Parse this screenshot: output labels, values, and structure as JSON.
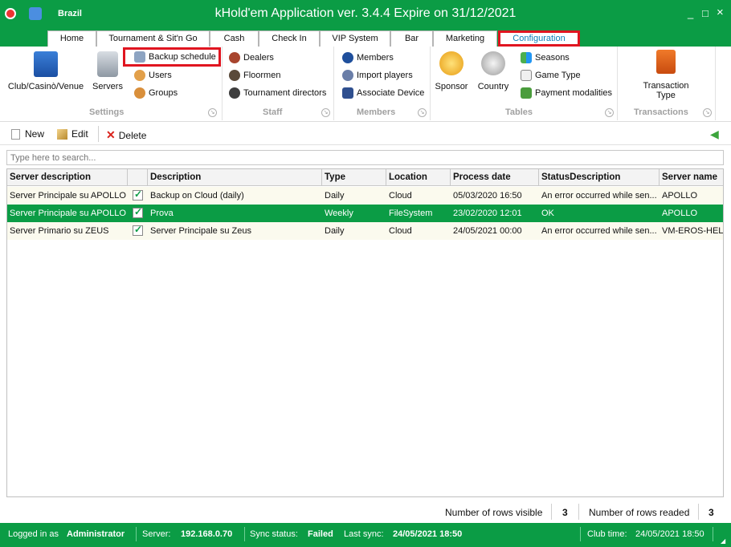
{
  "window": {
    "title": "kHold'em Application ver. 3.4.4 Expire on 31/12/2021",
    "club": "Brazil",
    "minimize": "_",
    "maximize": "□",
    "close": "×"
  },
  "tabs": [
    "Home",
    "Tournament & Sit'n Go",
    "Cash",
    "Check In",
    "VIP System",
    "Bar",
    "Marketing",
    "Configuration"
  ],
  "ribbon": {
    "settings": {
      "label": "Settings",
      "club": "Club/Casinò/Venue",
      "servers": "Servers",
      "backup": "Backup schedule",
      "users": "Users",
      "groups": "Groups"
    },
    "staff": {
      "label": "Staff",
      "dealers": "Dealers",
      "floormen": "Floormen",
      "directors": "Tournament directors"
    },
    "members": {
      "label": "Members",
      "members": "Members",
      "import": "Import players",
      "device": "Associate Device"
    },
    "tables": {
      "label": "Tables",
      "sponsor": "Sponsor",
      "country": "Country",
      "seasons": "Seasons",
      "gametype": "Game Type",
      "payment": "Payment modalities"
    },
    "transactions": {
      "label": "Transactions",
      "type_line1": "Transaction",
      "type_line2": "Type"
    }
  },
  "toolbar": {
    "new": "New",
    "edit": "Edit",
    "delete": "Delete"
  },
  "search": {
    "placeholder": "Type here to search..."
  },
  "grid": {
    "columns": [
      "Server description",
      "",
      "Description",
      "Type",
      "Location",
      "Process date",
      "StatusDescription",
      "Server name"
    ],
    "rows": [
      {
        "server": "Server Principale su APOLLO",
        "description": "Backup on Cloud (daily)",
        "type": "Daily",
        "location": "Cloud",
        "date": "05/03/2020 16:50",
        "status": "An error occurred while sen...",
        "name": "APOLLO"
      },
      {
        "server": "Server Principale su APOLLO",
        "description": "Prova",
        "type": "Weekly",
        "location": "FileSystem",
        "date": "23/02/2020 12:01",
        "status": "OK",
        "name": "APOLLO"
      },
      {
        "server": "Server Primario su ZEUS",
        "description": "Server Principale su Zeus",
        "type": "Daily",
        "location": "Cloud",
        "date": "24/05/2021 00:00",
        "status": "An error occurred while sen...",
        "name": "VM-EROS-HELP"
      }
    ]
  },
  "footer": {
    "visible_label": "Number of rows visible",
    "visible_count": "3",
    "readed_label": "Number of rows readed",
    "readed_count": "3"
  },
  "status": {
    "logged_label": "Logged in as",
    "user": "Administrator",
    "server_label": "Server:",
    "server": "192.168.0.70",
    "sync_label": "Sync status:",
    "sync": "Failed",
    "last_sync_label": "Last sync:",
    "last_sync": "24/05/2021 18:50",
    "clubtime_label": "Club time:",
    "clubtime": "24/05/2021 18:50"
  },
  "colors": {
    "brand_green": "#0b9c45",
    "highlight_red": "#e01520",
    "active_tab_text": "#0b7fba"
  }
}
